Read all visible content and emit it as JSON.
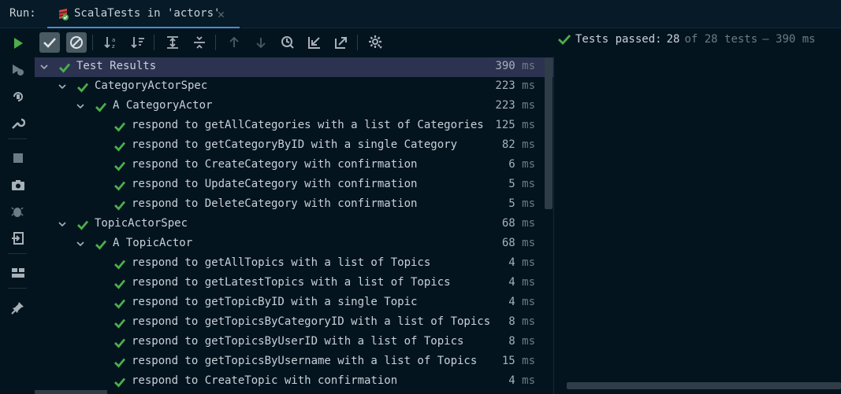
{
  "tabbar": {
    "run_label": "Run:",
    "tab_title": "ScalaTests in 'actors'",
    "tab_close": "✕"
  },
  "status": {
    "prefix": "Tests passed:",
    "passed": "28",
    "of_total": "of 28 tests",
    "duration": "– 390 ms"
  },
  "colors": {
    "background": "#04141f",
    "selected_row": "#2c3350",
    "pass_green": "#4cae4c",
    "run_green": "#4cae4c",
    "text": "#c9d1d9"
  },
  "top_toolbar": {
    "buttons": [
      {
        "icon": "show-passed-icon",
        "active": true
      },
      {
        "icon": "show-ignored-icon",
        "active": true
      },
      {
        "icon": "sort-alphabetically-icon"
      },
      {
        "icon": "sort-by-duration-icon"
      },
      {
        "icon": "expand-all-icon"
      },
      {
        "icon": "collapse-all-icon"
      },
      {
        "icon": "previous-failed-icon"
      },
      {
        "icon": "next-failed-icon"
      },
      {
        "icon": "test-history-icon"
      },
      {
        "icon": "import-tests-icon"
      },
      {
        "icon": "export-tests-icon"
      },
      {
        "icon": "settings-icon"
      }
    ]
  },
  "left_toolbar": {
    "buttons": [
      {
        "icon": "rerun-icon"
      },
      {
        "icon": "rerun-failed-icon"
      },
      {
        "icon": "toggle-auto-test-icon"
      },
      {
        "icon": "wrench-icon"
      },
      {
        "icon": "stop-icon"
      },
      {
        "icon": "camera-icon"
      },
      {
        "icon": "debug-icon"
      },
      {
        "icon": "exit-icon"
      },
      {
        "icon": "layout-icon"
      },
      {
        "icon": "pin-icon"
      }
    ]
  },
  "tree": {
    "rows": [
      {
        "label": "Test Results",
        "ms": "390",
        "level": 0,
        "expandable": true,
        "selected": true
      },
      {
        "label": "CategoryActorSpec",
        "ms": "223",
        "level": 1,
        "expandable": true
      },
      {
        "label": "A CategoryActor",
        "ms": "223",
        "level": 2,
        "expandable": true
      },
      {
        "label": "respond to getAllCategories with a list of Categories",
        "ms": "125",
        "level": 3
      },
      {
        "label": "respond to getCategoryByID with a single Category",
        "ms": "82",
        "level": 3
      },
      {
        "label": "respond to CreateCategory with confirmation",
        "ms": "6",
        "level": 3
      },
      {
        "label": "respond to UpdateCategory with confirmation",
        "ms": "5",
        "level": 3
      },
      {
        "label": "respond to DeleteCategory with confirmation",
        "ms": "5",
        "level": 3
      },
      {
        "label": "TopicActorSpec",
        "ms": "68",
        "level": 1,
        "expandable": true
      },
      {
        "label": "A TopicActor",
        "ms": "68",
        "level": 2,
        "expandable": true
      },
      {
        "label": "respond to getAllTopics with a list of Topics",
        "ms": "4",
        "level": 3
      },
      {
        "label": "respond to getLatestTopics with a list of Topics",
        "ms": "4",
        "level": 3
      },
      {
        "label": "respond to getTopicByID with a single Topic",
        "ms": "4",
        "level": 3
      },
      {
        "label": "respond to getTopicsByCategoryID with a list of Topics",
        "ms": "8",
        "level": 3
      },
      {
        "label": "respond to getTopicsByUserID with a list of Topics",
        "ms": "8",
        "level": 3
      },
      {
        "label": "respond to getTopicsByUsername with a list of Topics",
        "ms": "15",
        "level": 3
      },
      {
        "label": "respond to CreateTopic with confirmation",
        "ms": "4",
        "level": 3
      }
    ],
    "unit": "ms"
  }
}
